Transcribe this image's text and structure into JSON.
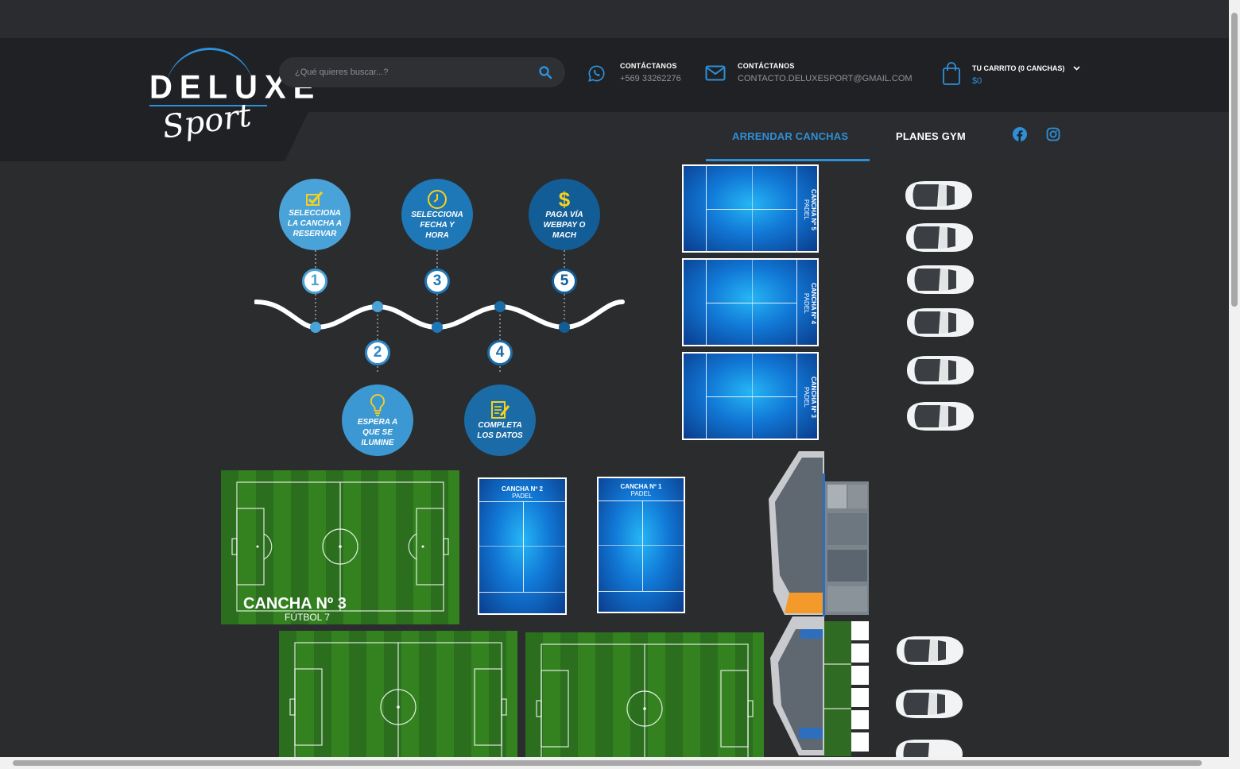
{
  "header": {
    "logo": {
      "word": "DELUXE",
      "script": "Sport"
    },
    "search": {
      "placeholder": "¿Qué quieres buscar...?"
    },
    "contacts": [
      {
        "title": "CONTÁCTANOS",
        "value": "+569 33262276",
        "icon": "whatsapp-icon"
      },
      {
        "title": "CONTÁCTANOS",
        "value": "CONTACTO.DELUXESPORT@GMAIL.COM",
        "icon": "mail-icon"
      }
    ],
    "cart": {
      "title": "TU CARRITO (0 CANCHAS)",
      "total": "$0",
      "icon": "shopping-bag-icon"
    }
  },
  "nav": {
    "items": [
      {
        "label": "ARRENDAR CANCHAS",
        "active": true
      },
      {
        "label": "PLANES GYM",
        "active": false
      }
    ],
    "social": [
      "facebook-icon",
      "instagram-icon"
    ]
  },
  "steps": [
    {
      "number": "1",
      "text": "SELECCIONA LA CANCHA A RESERVAR",
      "icon": "checkmark-icon"
    },
    {
      "number": "2",
      "text": "ESPERA A QUE SE ILUMINE",
      "icon": "lightbulb-icon"
    },
    {
      "number": "3",
      "text": "SELECCIONA FECHA Y HORA",
      "icon": "clock-icon"
    },
    {
      "number": "4",
      "text": "COMPLETA LOS DATOS",
      "icon": "form-icon"
    },
    {
      "number": "5",
      "text": "PAGA VÍA WEBPAY O MACH",
      "icon": "dollar-icon"
    }
  ],
  "courts": {
    "padel_right": [
      {
        "name": "CANCHA Nº 5",
        "type": "PADEL"
      },
      {
        "name": "CANCHA Nº 4",
        "type": "PADEL"
      },
      {
        "name": "CANCHA Nº 3",
        "type": "PADEL"
      }
    ],
    "padel_bottom": [
      {
        "name": "CANCHA Nº 2",
        "type": "PADEL"
      },
      {
        "name": "CANCHA Nº 1",
        "type": "PADEL"
      }
    ],
    "soccer": {
      "name": "CANCHA Nº 3",
      "type": "FÚTBOL 7"
    }
  },
  "colors": {
    "accent": "#2e8fd8",
    "header_bg": "#202124",
    "page_bg": "#2b2c2e"
  }
}
